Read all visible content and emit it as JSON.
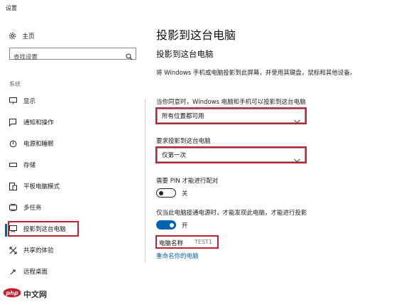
{
  "window": {
    "title": "设置"
  },
  "sidebar": {
    "home_label": "主页",
    "search_placeholder": "查找设置",
    "section_label": "系统",
    "items": [
      {
        "label": "显示",
        "icon": "monitor-icon"
      },
      {
        "label": "通知和操作",
        "icon": "notification-icon"
      },
      {
        "label": "电源和睡眠",
        "icon": "power-icon"
      },
      {
        "label": "存储",
        "icon": "storage-icon"
      },
      {
        "label": "平板电脑模式",
        "icon": "tablet-mode-icon"
      },
      {
        "label": "多任务",
        "icon": "multitasking-icon"
      },
      {
        "label": "投影到这台电脑",
        "icon": "projecting-icon",
        "active": true
      },
      {
        "label": "共享的体验",
        "icon": "shared-experiences-icon"
      },
      {
        "label": "远程桌面",
        "icon": "remote-desktop-icon"
      }
    ]
  },
  "main": {
    "page_title": "投影到这台电脑",
    "section_title": "投影到这台电脑",
    "description": "将 Windows 手机或电脑投影到此屏幕，并使用其键盘，鼠标和其他设备。",
    "availability_label": "当你同意时，Windows 电脑和手机可以投影到这台电脑",
    "availability_value": "所有位置都可用",
    "ask_label": "要求投影到这台电脑",
    "ask_value": "仅第一次",
    "pin_label": "需要 PIN 才能进行配对",
    "pin_state": "关",
    "power_label": "仅当此电脑接通电源时，才能发现此电脑，才能进行投影",
    "power_state": "开",
    "pc_name_label": "电脑名称",
    "pc_name_value": "TEST1",
    "rename_link": "重命名你的电脑"
  },
  "watermark": {
    "text": "中文网",
    "logo": "php"
  },
  "colors": {
    "accent": "#0063b1",
    "highlight_box": "#c21f2f"
  }
}
